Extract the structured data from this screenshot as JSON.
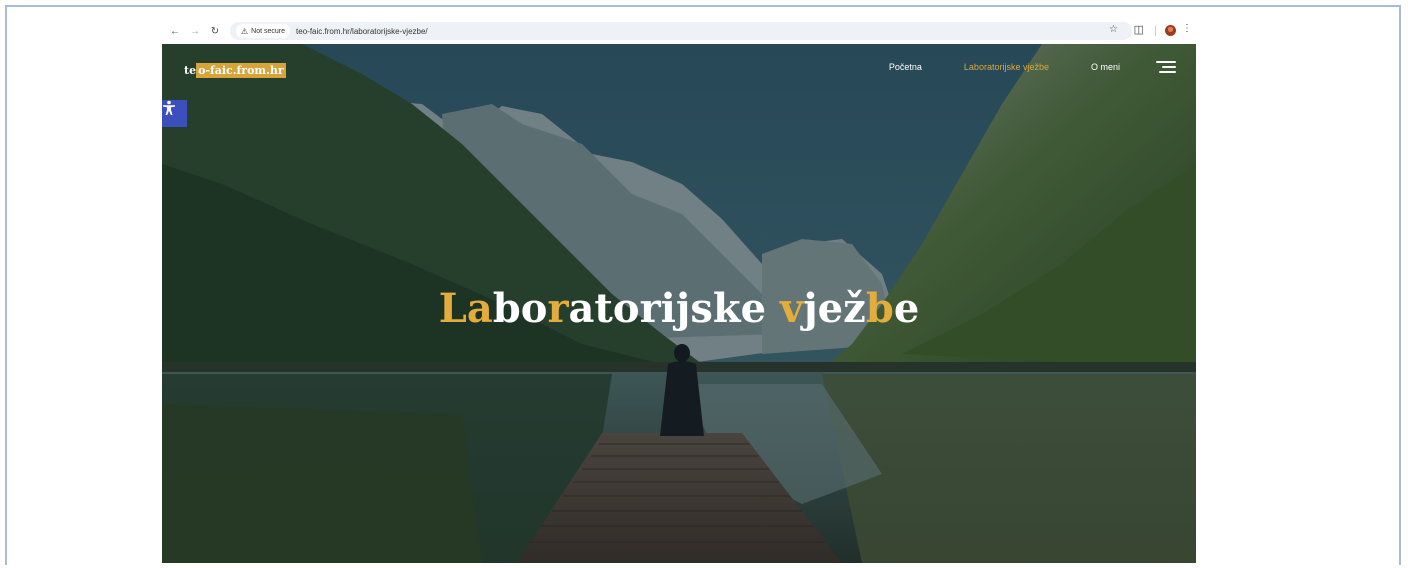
{
  "browser": {
    "security_label": "Not secure",
    "url": "teo-faic.from.hr/laboratorijske-vjezbe/",
    "icons": {
      "back": "arrow-left-icon",
      "forward": "arrow-right-icon",
      "reload": "reload-icon",
      "security": "warning-triangle-icon",
      "bookmark": "star-icon",
      "extensions": "puzzle-icon",
      "profile": "profile-avatar-icon",
      "menu": "more-vertical-icon"
    }
  },
  "site": {
    "logo": {
      "prefix": "te",
      "highlighted": "o-faic.from.hr"
    },
    "nav": [
      {
        "label": "Početna",
        "active": false
      },
      {
        "label": "Laboratorijske vježbe",
        "active": true
      },
      {
        "label": "O meni",
        "active": false
      }
    ],
    "menu_icon": "hamburger-menu-icon",
    "accessibility_icon": "accessibility-person-icon"
  },
  "hero": {
    "title_parts": [
      {
        "text": "La",
        "accent": true
      },
      {
        "text": "bo",
        "accent": false
      },
      {
        "text": "r",
        "accent": true
      },
      {
        "text": "atorijske ",
        "accent": false
      },
      {
        "text": "v",
        "accent": true
      },
      {
        "text": "jež",
        "accent": false
      },
      {
        "text": "b",
        "accent": true
      },
      {
        "text": "e",
        "accent": false
      }
    ]
  },
  "colors": {
    "accent": "#d9a93f",
    "accessibility_bg": "#3b4fbd",
    "frame_border": "#a9bcd6"
  }
}
